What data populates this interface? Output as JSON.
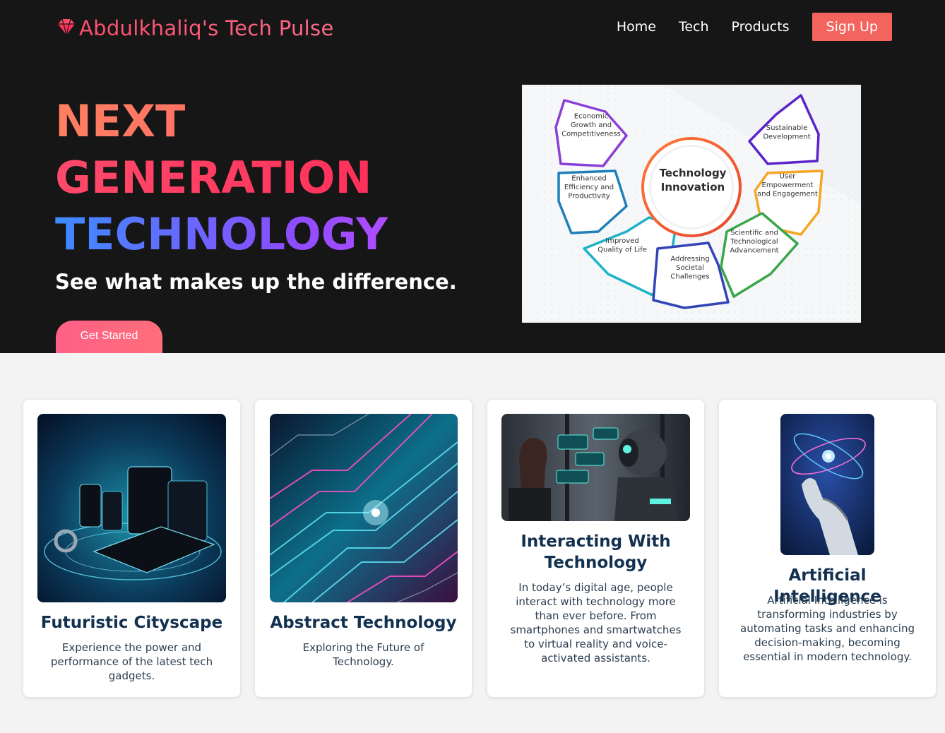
{
  "brand": {
    "name": "Abdulkhaliq's Tech Pulse",
    "icon": "diamond-icon"
  },
  "nav": {
    "home": "Home",
    "tech": "Tech",
    "products": "Products",
    "signup": "Sign Up"
  },
  "hero": {
    "line1": "NEXT",
    "line2": "GENERATION",
    "line3": "TECHNOLOGY",
    "tagline": "See what makes up the difference.",
    "cta": "Get Started"
  },
  "diagram": {
    "center_line1": "Technology",
    "center_line2": "Innovation",
    "nodes": [
      {
        "lines": [
          "Economic",
          "Growth and",
          "Competitiveness"
        ],
        "color": "#8a3fd6"
      },
      {
        "lines": [
          "Sustainable",
          "Development"
        ],
        "color": "#5b24c9"
      },
      {
        "lines": [
          "Enhanced",
          "Efficiency and",
          "Productivity"
        ],
        "color": "#1f7fb8"
      },
      {
        "lines": [
          "User",
          "Empowerment",
          "and Engagement"
        ],
        "color": "#f5a623"
      },
      {
        "lines": [
          "Improved",
          "Quality of Life"
        ],
        "color": "#1fb3c6"
      },
      {
        "lines": [
          "Addressing",
          "Societal",
          "Challenges"
        ],
        "color": "#3344b8"
      },
      {
        "lines": [
          "Scientific and",
          "Technological",
          "Advancement"
        ],
        "color": "#3aa64a"
      }
    ]
  },
  "cards": [
    {
      "title": "Futuristic Cityscape",
      "text": "Experience the power and performance of the latest tech gadgets.",
      "image": "gadgets-image"
    },
    {
      "title": "Abstract Technology",
      "text": "Exploring the Future of Technology.",
      "image": "circuit-image"
    },
    {
      "title": "Interacting With Technology",
      "text": "In today’s digital age, people interact with technology more than ever before. From smartphones and smartwatches to virtual reality and voice-activated assistants.",
      "image": "human-robot-image"
    },
    {
      "title": "Artificial Intelligence",
      "text": "Artificial Intelligence is transforming industries by automating tasks and enhancing decision-making, becoming essential in modern technology.",
      "image": "robot-hand-image"
    }
  ],
  "colors": {
    "accent": "#f4645f",
    "heroBg": "#161616",
    "title": "#12304f"
  }
}
